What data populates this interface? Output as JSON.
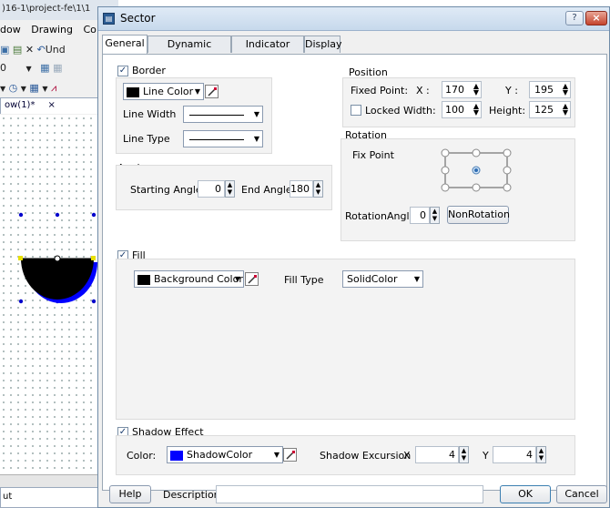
{
  "background": {
    "path_text": ")16-1\\project-fe\\1\\1",
    "menu": [
      "dow",
      "Drawing",
      "Co"
    ],
    "toolbar_undo": "Und",
    "toolbar_zero": "0",
    "tab_label": "ow(1)*",
    "tab_close": "×",
    "bottom_label": "ut"
  },
  "dialog": {
    "title": "Sector",
    "help_glyph": "?",
    "close_glyph": "×",
    "tabs": [
      "General",
      "Dynamic Graphics",
      "Indicator Light",
      "Display"
    ],
    "border": {
      "label": "Border",
      "checked": "✓",
      "line_color": "Line Color",
      "line_width_label": "Line Width",
      "line_type_label": "Line Type"
    },
    "angle": {
      "label": "Angle",
      "start_label": "Starting Angle",
      "start_value": "0",
      "end_label": "End Angle",
      "end_value": "180"
    },
    "position": {
      "label": "Position",
      "fixed_point_label": "Fixed Point:",
      "x_label": "X :",
      "x_value": "170",
      "y_label": "Y :",
      "y_value": "195",
      "locked_label": "Locked",
      "width_label": "Width:",
      "width_value": "100",
      "height_label": "Height:",
      "height_value": "125"
    },
    "rotation": {
      "label": "Rotation",
      "fix_point_label": "Fix Point",
      "angle_label": "RotationAngle",
      "angle_value": "0",
      "non_rotation_button": "NonRotation"
    },
    "fill": {
      "label": "Fill",
      "checked": "✓",
      "color_label": "Background Color",
      "fill_type_label": "Fill Type",
      "fill_type_value": "SolidColor"
    },
    "shadow": {
      "label": "Shadow Effect",
      "checked": "✓",
      "color_label": "Color:",
      "color_value": "ShadowColor",
      "excursion_label": "Shadow Excursion",
      "x_label": "X",
      "x_value": "4",
      "y_label": "Y",
      "y_value": "4"
    },
    "footer": {
      "help_button": "Help",
      "description_label": "Description:",
      "description_value": "",
      "ok_button": "OK",
      "cancel_button": "Cancel"
    },
    "colors": {
      "line_color": "#000000",
      "background_color": "#000000",
      "shadow_color": "#0000ff",
      "sector_fill": "#000000",
      "sector_shadow": "#0000ff"
    }
  }
}
